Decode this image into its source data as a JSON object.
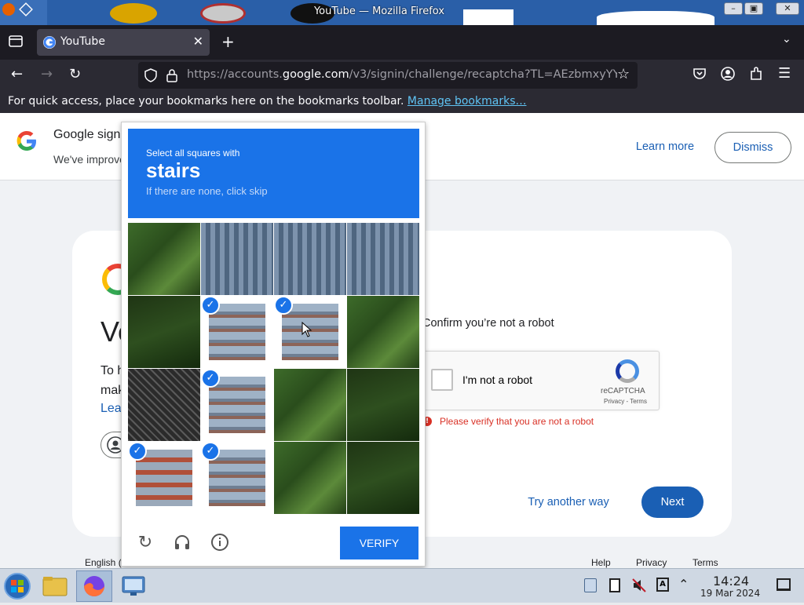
{
  "window": {
    "title": "YouTube — Mozilla Firefox",
    "controls": [
      "–",
      "▣",
      "✕"
    ]
  },
  "browser": {
    "tab_title": "YouTube",
    "url_prefix": "https://accounts.",
    "url_domain": "google.com",
    "url_rest": "/v3/signin/challenge/recaptcha?TL=AEzbmxyYYN",
    "bookmarks_text": "For quick access, place your bookmarks here on the bookmarks toolbar.",
    "bookmarks_link": "Manage bookmarks…"
  },
  "banner": {
    "title": "Google sign",
    "subtitle": "We've improve",
    "learn_more": "Learn more",
    "dismiss": "Dismiss"
  },
  "card": {
    "heading_partial": "Ve",
    "text_line1": "To h",
    "text_line2": "mak",
    "link_partial": "Lea",
    "confirm_text": "Confirm you’re not a robot",
    "checkbox_label": "I'm not a robot",
    "recaptcha_brand": "reCAPTCHA",
    "recaptcha_terms": "Privacy - Terms",
    "error_text": "Please verify that you are not a robot",
    "try_another": "Try another way",
    "next": "Next"
  },
  "footer": {
    "language": "English (",
    "help": "Help",
    "privacy": "Privacy",
    "terms": "Terms"
  },
  "captcha": {
    "instruction": "Select all squares with",
    "target": "stairs",
    "hint": "If there are none, click skip",
    "verify": "VERIFY",
    "tiles": [
      {
        "selected": false,
        "tone": "foliage"
      },
      {
        "selected": false,
        "tone": "stairs-rail"
      },
      {
        "selected": false,
        "tone": "stairs-rail"
      },
      {
        "selected": false,
        "tone": "stairs-rail"
      },
      {
        "selected": false,
        "tone": "foliage-dark"
      },
      {
        "selected": true,
        "tone": "stairs"
      },
      {
        "selected": true,
        "tone": "stairs"
      },
      {
        "selected": false,
        "tone": "foliage"
      },
      {
        "selected": false,
        "tone": "fence"
      },
      {
        "selected": true,
        "tone": "stairs"
      },
      {
        "selected": false,
        "tone": "foliage"
      },
      {
        "selected": false,
        "tone": "foliage-dark"
      },
      {
        "selected": true,
        "tone": "stairs-red"
      },
      {
        "selected": true,
        "tone": "stairs"
      },
      {
        "selected": false,
        "tone": "foliage"
      },
      {
        "selected": false,
        "tone": "foliage-dark"
      }
    ]
  },
  "taskbar": {
    "time": "14:24",
    "date": "19 Mar 2024"
  },
  "colors": {
    "accent": "#1a73e8",
    "error": "#d93025",
    "link_blue": "#1a5fb4"
  }
}
